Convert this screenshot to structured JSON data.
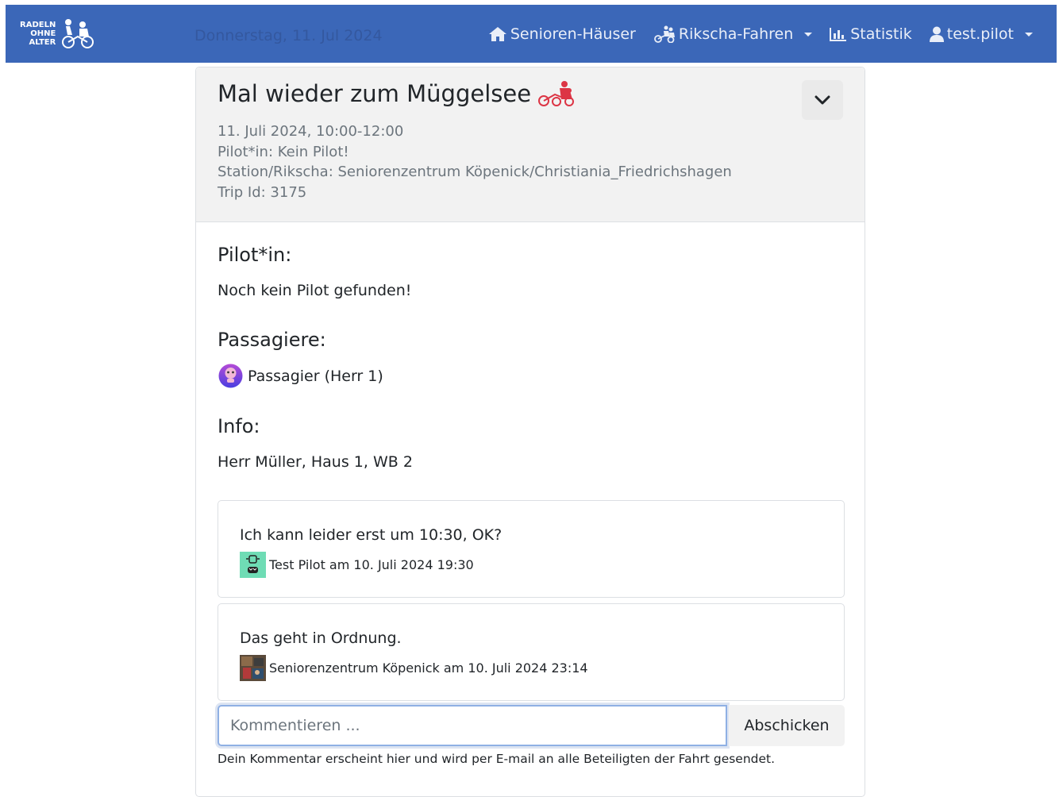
{
  "navbar": {
    "brand_lines": [
      "RADELN",
      "OHNE",
      "ALTER"
    ],
    "date": "Donnerstag, 11. Jul 2024",
    "items": [
      {
        "label": "Senioren-Häuser",
        "icon": "home-icon"
      },
      {
        "label": "Rikscha-Fahren",
        "icon": "rickshaw-icon"
      },
      {
        "label": "Statistik",
        "icon": "bar-chart-icon"
      },
      {
        "label": "test.pilot",
        "icon": "user-icon"
      }
    ]
  },
  "trip": {
    "title": "Mal wieder zum Müggelsee",
    "date_line": "11. Juli 2024, 10:00-12:00",
    "pilot_line": "Pilot*in: Kein Pilot!",
    "station_line": "Station/Rikscha: Seniorenzentrum Köpenick/Christiania_Friedrichshagen",
    "trip_id_line": "Trip Id: 3175",
    "title_icon_color": "#dc3545"
  },
  "sections": {
    "pilot_heading": "Pilot*in:",
    "pilot_text": "Noch kein Pilot gefunden!",
    "passengers_heading": "Passagiere:",
    "passenger_name": "Passagier (Herr 1)",
    "info_heading": "Info:",
    "info_text": "Herr Müller, Haus 1, WB 2"
  },
  "comments": [
    {
      "text": "Ich kann leider erst um 10:30, OK?",
      "meta": "Test Pilot am 10. Juli 2024 19:30"
    },
    {
      "text": "Das geht in Ordnung.",
      "meta": "Seniorenzentrum Köpenick am 10. Juli 2024 23:14"
    }
  ],
  "comment_form": {
    "placeholder": "Kommentieren ...",
    "submit_label": "Abschicken",
    "help": "Dein Kommentar erscheint hier und wird per E-mail an alle Beteiligten der Fahrt gesendet."
  },
  "colors": {
    "navbar": "#3b67b8",
    "accent": "#dc3545"
  }
}
